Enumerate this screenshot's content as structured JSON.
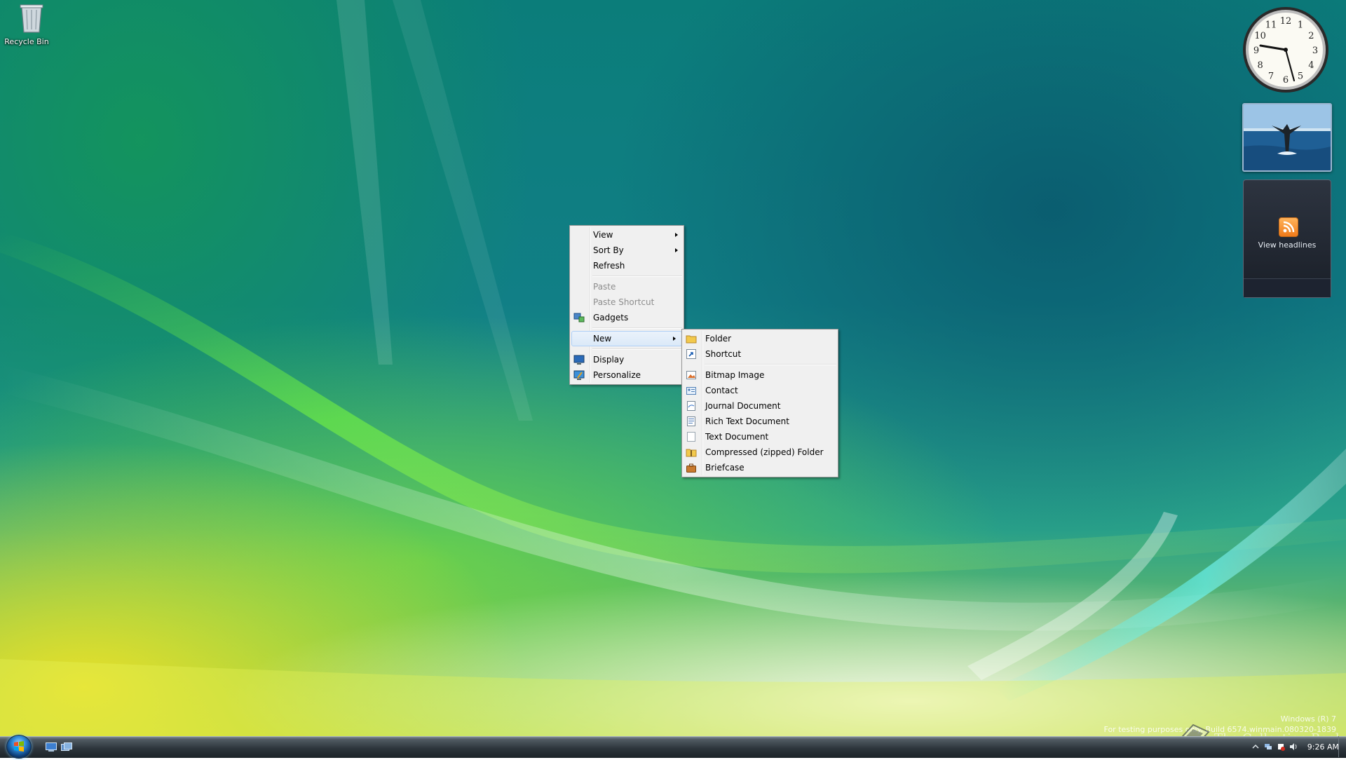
{
  "desktop": {
    "icons": [
      {
        "label": "Recycle Bin",
        "icon": "recycle-bin-icon"
      }
    ]
  },
  "gadgets": {
    "clock": {
      "numerals": [
        "12",
        "1",
        "2",
        "3",
        "4",
        "5",
        "6",
        "7",
        "8",
        "9",
        "10",
        "11"
      ],
      "time": "9:26"
    },
    "feed": {
      "label": "View headlines",
      "icon": "rss-icon"
    },
    "slideshow": {
      "subject": "whale tail"
    }
  },
  "context_menu": {
    "items": [
      {
        "label": "View",
        "submenu": true
      },
      {
        "label": "Sort By",
        "submenu": true
      },
      {
        "label": "Refresh"
      },
      {
        "separator": true
      },
      {
        "label": "Paste",
        "disabled": true
      },
      {
        "label": "Paste Shortcut",
        "disabled": true
      },
      {
        "label": "Gadgets",
        "icon": "gadgets-icon"
      },
      {
        "separator": true
      },
      {
        "label": "New",
        "submenu": true,
        "highlighted": true
      },
      {
        "separator": true
      },
      {
        "label": "Display",
        "icon": "display-icon"
      },
      {
        "label": "Personalize",
        "icon": "personalize-icon"
      }
    ]
  },
  "new_submenu": {
    "items": [
      {
        "label": "Folder",
        "icon": "folder-icon"
      },
      {
        "label": "Shortcut",
        "icon": "shortcut-icon"
      },
      {
        "separator": true
      },
      {
        "label": "Bitmap Image",
        "icon": "bitmap-image-icon"
      },
      {
        "label": "Contact",
        "icon": "contact-icon"
      },
      {
        "label": "Journal Document",
        "icon": "journal-document-icon"
      },
      {
        "label": "Rich Text Document",
        "icon": "rich-text-document-icon"
      },
      {
        "label": "Text Document",
        "icon": "text-document-icon"
      },
      {
        "label": "Compressed (zipped) Folder",
        "icon": "zip-folder-icon"
      },
      {
        "label": "Briefcase",
        "icon": "briefcase-icon"
      }
    ]
  },
  "watermark": {
    "line1": "Windows (R) 7",
    "line2": "For testing purposes only. Build 6574.winmain.080320-1839",
    "logo_text": "The Collection Book"
  },
  "taskbar": {
    "time": "9:26 AM",
    "quick_launch": [
      "show-desktop-icon",
      "switch-windows-icon"
    ],
    "tray_icons": [
      "tray-expand-icon",
      "network-icon",
      "action-center-icon",
      "volume-icon"
    ]
  },
  "colors": {
    "menu_bg": "#f0f0f0",
    "menu_highlight": "#dbe9f8",
    "menu_highlight_border": "#aecff7",
    "disabled_text": "#8d8d8d",
    "taskbar": "#2d353c"
  }
}
